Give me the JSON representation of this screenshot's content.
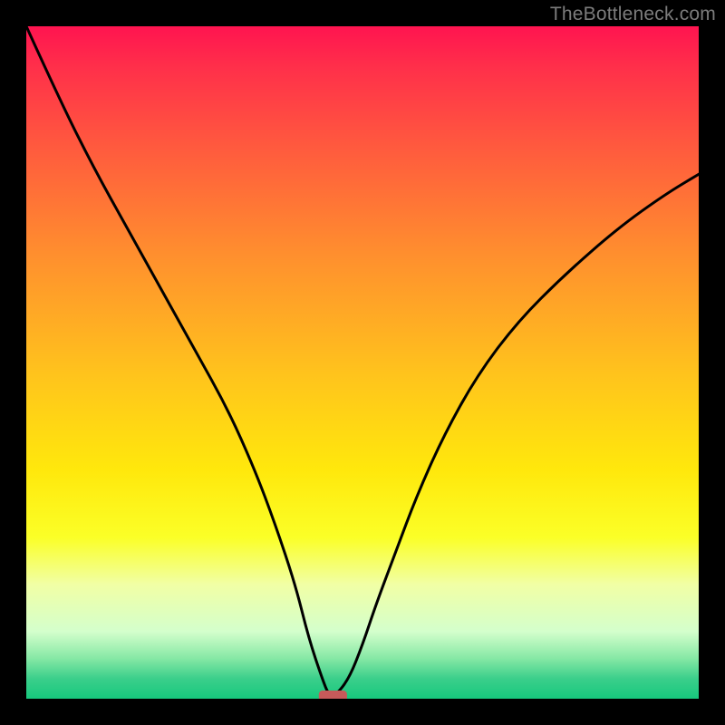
{
  "watermark": "TheBottleneck.com",
  "chart_data": {
    "type": "line",
    "x_range": [
      0,
      100
    ],
    "y_range": [
      0,
      100
    ],
    "title": "",
    "xlabel": "",
    "ylabel": "",
    "series": [
      {
        "name": "curve",
        "x": [
          0,
          5,
          10,
          15,
          20,
          25,
          30,
          34,
          37,
          40,
          42,
          44,
          45,
          46,
          48,
          50,
          52,
          55,
          58,
          62,
          67,
          73,
          80,
          88,
          95,
          100
        ],
        "y": [
          100,
          89,
          79,
          70,
          61,
          52,
          43,
          34,
          26,
          17,
          9,
          3,
          0.5,
          0.5,
          3,
          8,
          14,
          22,
          30,
          39,
          48,
          56,
          63,
          70,
          75,
          78
        ]
      }
    ],
    "marker": {
      "x_start": 43.5,
      "x_end": 47.7,
      "y": 0.4
    },
    "gradient_stops": [
      {
        "pct": 0,
        "color": "#ff1450"
      },
      {
        "pct": 50,
        "color": "#ffc41c"
      },
      {
        "pct": 80,
        "color": "#f1ffa5"
      },
      {
        "pct": 100,
        "color": "#17c87d"
      }
    ]
  }
}
